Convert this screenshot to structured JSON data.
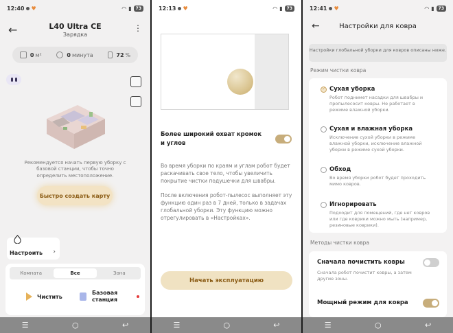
{
  "panel1": {
    "status": {
      "time": "12:40",
      "battery": "73"
    },
    "device_name": "L40 Ultra CE",
    "device_status": "Зарядка",
    "stats": {
      "area": "0",
      "area_unit": "м²",
      "time": "0",
      "time_unit": "минута",
      "battery": "72",
      "battery_unit": "%"
    },
    "hint": "Рекомендуется начать первую уборку с базовой станции, чтобы точно определить местоположение.",
    "map_button": "Быстро создать карту",
    "setup_label": "Настроить",
    "tabs": [
      "Комната",
      "Все",
      "Зона"
    ],
    "clean_label": "Чистить",
    "station_label": "Базовая станция"
  },
  "panel2": {
    "status": {
      "time": "12:13",
      "battery": "73"
    },
    "option_title": "Более широкий охват кромок и углов",
    "option_enabled": true,
    "desc1": "Во время уборки по краям и углам робот будет раскачивать свое тело, чтобы увеличить покрытие чистки подушечки для швабры.",
    "desc2": "После включения робот-пылесос выполняет эту функцию один раз в 7 дней, только в задачах глобальной уборки. Эту функцию можно отрегулировать в «Настройках».",
    "start_button": "Начать эксплуатацию"
  },
  "panel3": {
    "status": {
      "time": "12:41",
      "battery": "73"
    },
    "title": "Настройки для ковра",
    "notice": "Настройки глобальной уборки для ковров описаны ниже.",
    "section1": "Режим чистки ковра",
    "modes": [
      {
        "title": "Сухая уборка",
        "desc": "Робот поднимет насадки для швабры и пропылесосит ковры. Не работает в режиме влажной уборки.",
        "selected": true
      },
      {
        "title": "Сухая и влажная уборка",
        "desc": "Исключение сухой уборки в режиме влажной уборки, исключение влажной уборки в режиме сухой уборки.",
        "selected": false
      },
      {
        "title": "Обход",
        "desc": "Во время уборки робот будет проходить мимо ковров.",
        "selected": false
      },
      {
        "title": "Игнорировать",
        "desc": "Подходит для помещений, где нет ковров или где коврики можно мыть (например, резиновые коврики).",
        "selected": false
      }
    ],
    "section2": "Методы чистки ковра",
    "method1_title": "Сначала почистить ковры",
    "method1_desc": "Сначала робот почистит ковры, а затем другие зоны.",
    "method1_enabled": false,
    "method2_title": "Мощный режим для ковра",
    "method2_enabled": true
  },
  "colors": {
    "accent": "#c7ad7b",
    "button_bg": "#f0e2c2",
    "button_text": "#8a5b14"
  },
  "icons": [
    "back-arrow-icon",
    "more-vert-icon",
    "area-icon",
    "clock-icon",
    "battery-icon",
    "map-edit-icon",
    "map-settings-icon",
    "drop-icon",
    "play-icon",
    "station-icon",
    "menu-icon",
    "home-icon",
    "back-icon"
  ]
}
